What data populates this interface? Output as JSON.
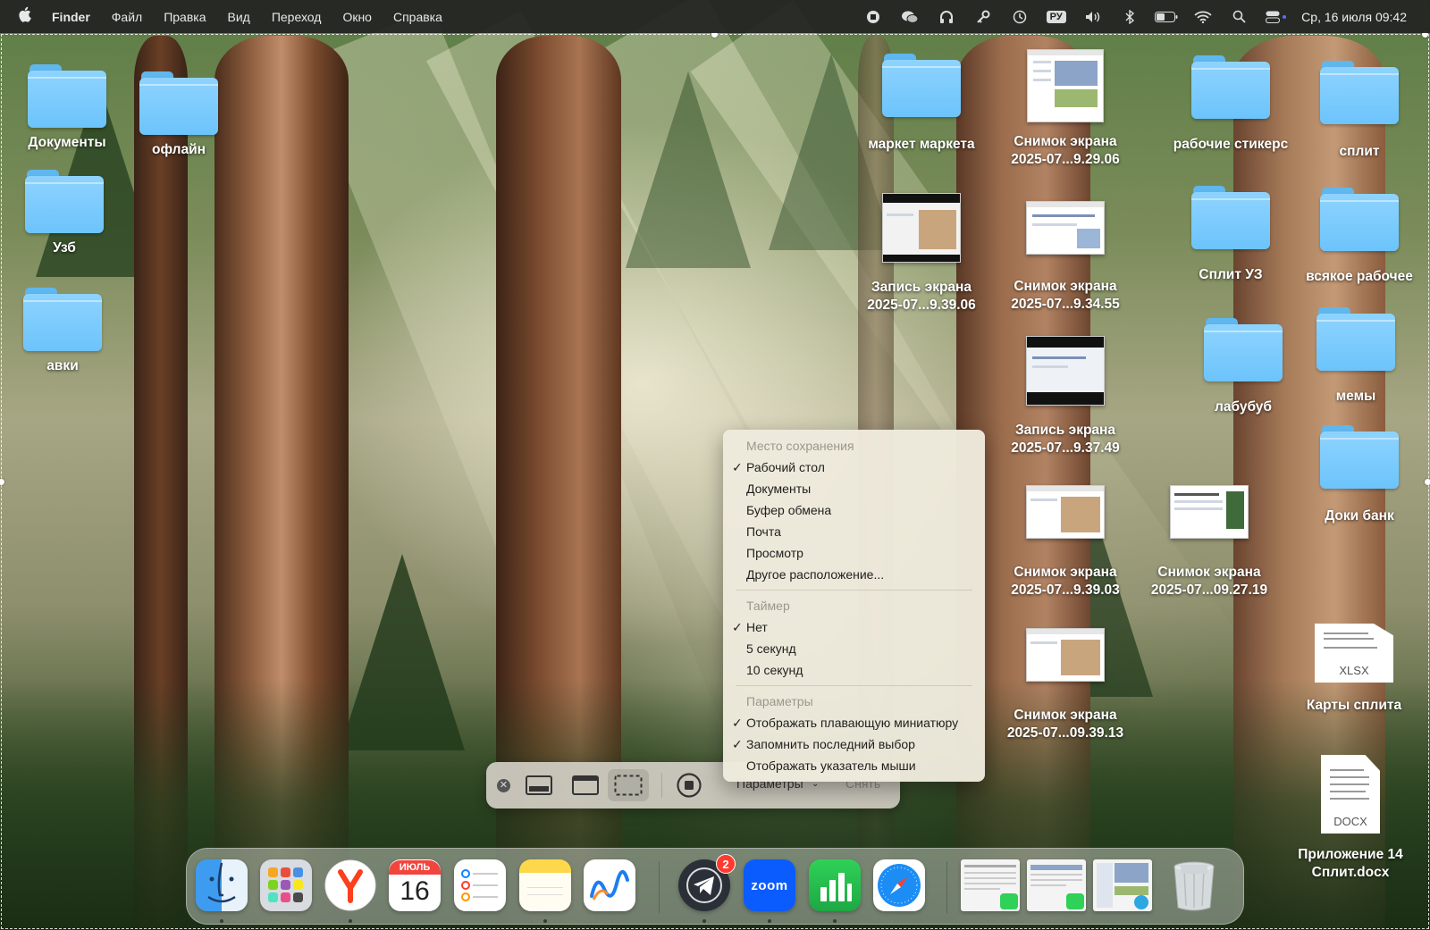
{
  "menubar": {
    "app_name": "Finder",
    "items": [
      "Файл",
      "Правка",
      "Вид",
      "Переход",
      "Окно",
      "Справка"
    ],
    "input_source": "РУ",
    "clock": "Ср, 16 июля  09:42"
  },
  "desktop": {
    "left_folders": [
      {
        "label": "Документы"
      },
      {
        "label": "офлайн"
      },
      {
        "label": "Узб"
      },
      {
        "label": "авки"
      }
    ],
    "items": {
      "market": {
        "label": "маркет маркета"
      },
      "shot_92906": {
        "label_line1": "Снимок экрана",
        "label_line2": "2025-07...9.29.06"
      },
      "rabochie": {
        "label": "рабочие стикерс"
      },
      "split": {
        "label": "сплит"
      },
      "rec_93906": {
        "label_line1": "Запись экрана",
        "label_line2": "2025-07...9.39.06"
      },
      "shot_93455": {
        "label_line1": "Снимок экрана",
        "label_line2": "2025-07...9.34.55"
      },
      "split_uz": {
        "label": "Сплит УЗ"
      },
      "vsyakoe": {
        "label": "всякое рабочее"
      },
      "rec_93749": {
        "label_line1": "Запись экрана",
        "label_line2": "2025-07...9.37.49"
      },
      "labubub": {
        "label": "лабубуб"
      },
      "memy": {
        "label": "мемы"
      },
      "shot_93903": {
        "label_line1": "Снимок экрана",
        "label_line2": "2025-07...9.39.03"
      },
      "shot_092719": {
        "label_line1": "Снимок экрана",
        "label_line2": "2025-07...09.27.19"
      },
      "doki_bank": {
        "label": "Доки банк"
      },
      "shot_093913": {
        "label_line1": "Снимок экрана",
        "label_line2": "2025-07...09.39.13"
      },
      "karty": {
        "label": "Карты сплита",
        "ext": "XLSX"
      },
      "prilozhenie": {
        "label_line1": "Приложение 14",
        "label_line2": "Сплит.docx",
        "ext": "DOCX"
      }
    }
  },
  "toolbar": {
    "options_label": "Параметры",
    "capture_label": "Снять"
  },
  "dropdown": {
    "save_header": "Место сохранения",
    "save_items": [
      {
        "label": "Рабочий стол",
        "checked": true
      },
      {
        "label": "Документы",
        "checked": false
      },
      {
        "label": "Буфер обмена",
        "checked": false
      },
      {
        "label": "Почта",
        "checked": false
      },
      {
        "label": "Просмотр",
        "checked": false
      },
      {
        "label": "Другое расположение...",
        "checked": false
      }
    ],
    "timer_header": "Таймер",
    "timer_items": [
      {
        "label": "Нет",
        "checked": true
      },
      {
        "label": "5 секунд",
        "checked": false
      },
      {
        "label": "10 секунд",
        "checked": false
      }
    ],
    "options_header": "Параметры",
    "options_items": [
      {
        "label": "Отображать плавающую миниатюру",
        "checked": true
      },
      {
        "label": "Запомнить последний выбор",
        "checked": true
      },
      {
        "label": "Отображать указатель мыши",
        "checked": false
      }
    ],
    "check_glyph": "✓"
  },
  "dock": {
    "calendar_month": "ИЮЛЬ",
    "calendar_day": "16",
    "telegram_badge": "2",
    "zoom_label": "zoom",
    "apps": [
      "finder-icon",
      "launchpad-icon",
      "yandex-browser-icon",
      "calendar-icon",
      "reminders-icon",
      "notes-icon",
      "freeform-icon",
      "telegram-icon",
      "zoom-icon",
      "numbers-icon",
      "safari-icon",
      "trash-icon"
    ]
  }
}
